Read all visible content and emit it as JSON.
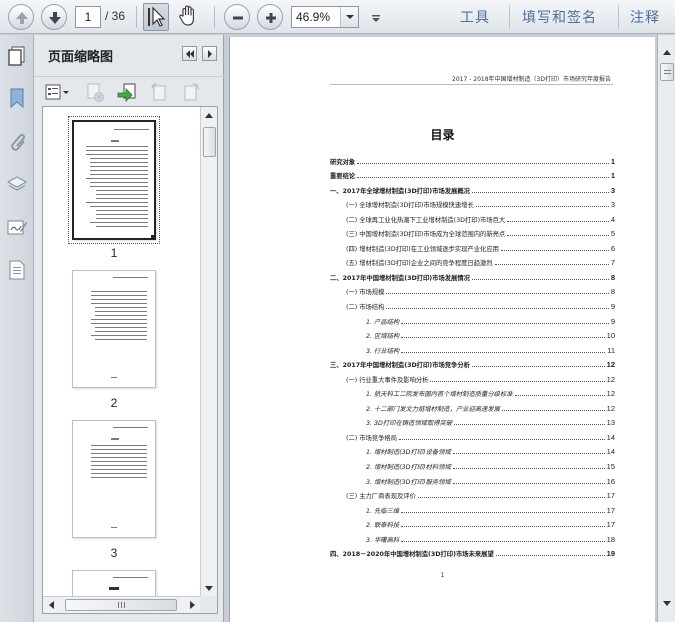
{
  "toolbar": {
    "page_current": "1",
    "page_total": "/ 36",
    "zoom": "46.9%",
    "menu_tools": "工具",
    "menu_fill_sign": "填写和签名",
    "menu_comment": "注释"
  },
  "sidebar": {
    "rail_icons": [
      "bookmark-icon",
      "attachment-icon",
      "layers-icon",
      "signature-icon",
      "page-icon"
    ]
  },
  "panel": {
    "title": "页面缩略图",
    "thumbnails": [
      {
        "label": "1"
      },
      {
        "label": "2"
      },
      {
        "label": "3"
      }
    ]
  },
  "document": {
    "header": "2017 - 2018年中国增材制造（3D打印）市场研究年度报告",
    "toc_title": "目录",
    "footer": "1",
    "toc": [
      {
        "level": 1,
        "label": "研究对象",
        "page": "1"
      },
      {
        "level": 1,
        "label": "重要结论",
        "page": "1"
      },
      {
        "level": 1,
        "label": "一、2017年全球增材制造(3D打印)市场发展概况",
        "page": "3"
      },
      {
        "level": 2,
        "label": "(一) 全球增材制造(3D打印)市场规模快速增长",
        "page": "3"
      },
      {
        "level": 2,
        "label": "(二) 全球再工业化热潮下工业增材制造(3D打印)市场巨大",
        "page": "4"
      },
      {
        "level": 2,
        "label": "(三) 中国增材制造(3D打印)市场成为全球范围内的新亮点",
        "page": "5"
      },
      {
        "level": 2,
        "label": "(四) 增材制造(3D打印)在工业领域逐步实现产业化应用",
        "page": "6"
      },
      {
        "level": 2,
        "label": "(五) 增材制造(3D打印)企业之间的竞争程度日趋激烈",
        "page": "7"
      },
      {
        "level": 1,
        "label": "二、2017年中国增材制造(3D打印)市场发展情况",
        "page": "8"
      },
      {
        "level": 2,
        "label": "(一) 市场规模",
        "page": "8"
      },
      {
        "level": 2,
        "label": "(二) 市场结构",
        "page": "9"
      },
      {
        "level": 3,
        "label": "1. 产品结构",
        "page": "9"
      },
      {
        "level": 3,
        "label": "2. 区域结构",
        "page": "10"
      },
      {
        "level": 3,
        "label": "3. 行业结构",
        "page": "11"
      },
      {
        "level": 1,
        "label": "三、2017年中国增材制造(3D打印)市场竞争分析",
        "page": "12"
      },
      {
        "level": 2,
        "label": "(一) 行业重大事件及影响分析",
        "page": "12"
      },
      {
        "level": 3,
        "label": "1. 航天科工二院发布国内首个增材制造质量分级标准",
        "page": "12"
      },
      {
        "level": 3,
        "label": "2. 十二部门发文力挺增材制造，产业迎高速发展",
        "page": "12"
      },
      {
        "level": 3,
        "label": "3. 3D打印在铸造领域取得突破",
        "page": "13"
      },
      {
        "level": 2,
        "label": "(二) 市场竞争格局",
        "page": "14"
      },
      {
        "level": 3,
        "label": "1. 增材制造(3D打印)设备领域",
        "page": "14"
      },
      {
        "level": 3,
        "label": "2. 增材制造(3D打印)材料领域",
        "page": "15"
      },
      {
        "level": 3,
        "label": "3. 增材制造(3D打印)服务领域",
        "page": "16"
      },
      {
        "level": 2,
        "label": "(三) 主力厂商表现及评价",
        "page": "17"
      },
      {
        "level": 3,
        "label": "1. 先临三维",
        "page": "17"
      },
      {
        "level": 3,
        "label": "2. 联泰科技",
        "page": "17"
      },
      {
        "level": 3,
        "label": "3. 华曙高科",
        "page": "18"
      },
      {
        "level": 1,
        "label": "四、2018－2020年中国增材制造(3D打印)市场未来展望",
        "page": "19"
      }
    ]
  },
  "colors": {
    "accent_menu": "#4e6f97",
    "toolbar_bg": "#e6eaef",
    "workspace_bg": "#c9ced6"
  }
}
